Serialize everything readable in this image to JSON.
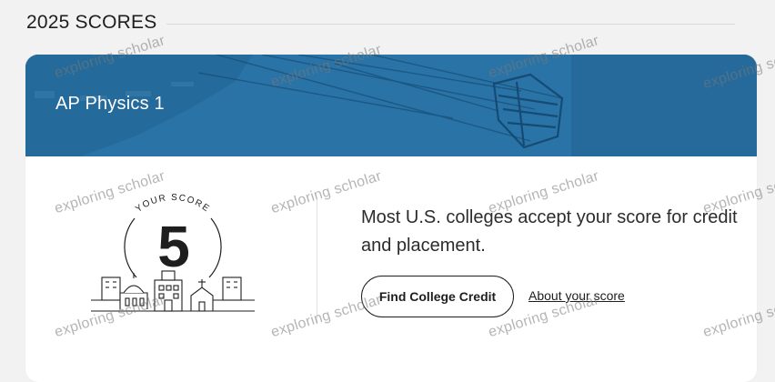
{
  "section": {
    "title": "2025 SCORES"
  },
  "card": {
    "course_title": "AP Physics 1",
    "score_caption": "YOUR SCORE",
    "score": "5",
    "message": "Most U.S. colleges accept your score for credit and placement.",
    "primary_button": "Find College Credit",
    "secondary_link": "About your score"
  },
  "watermark": {
    "text": "exploring scholar"
  },
  "colors": {
    "banner": "#2a73a6",
    "background": "#f2f2f2",
    "card": "#ffffff",
    "text": "#1e1e1e"
  }
}
